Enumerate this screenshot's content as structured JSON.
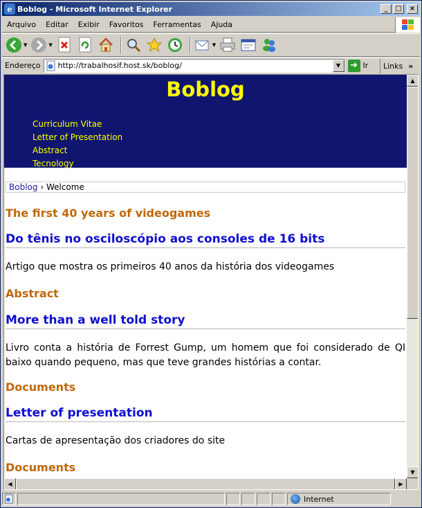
{
  "window": {
    "title": "Boblog - Microsoft Internet Explorer",
    "controls": {
      "minimize": "_",
      "maximize": "□",
      "close": "×"
    }
  },
  "menu": {
    "items": [
      "Arquivo",
      "Editar",
      "Exibir",
      "Favoritos",
      "Ferramentas",
      "Ajuda"
    ]
  },
  "address": {
    "label": "Endereço",
    "url": "http://trabalhosif.host.sk/boblog/",
    "go_label": "Ir",
    "links_label": "Links",
    "links_chevron": "»"
  },
  "page": {
    "site_title": "Boblog",
    "nav": [
      "Curriculum Vitae",
      "Letter of Presentation",
      "Abstract",
      "Tecnology"
    ],
    "breadcrumb": {
      "home": "Boblog",
      "separator": "›",
      "current": "Welcome"
    },
    "articles": [
      {
        "category": "The first 40 years of videogames",
        "title": "Do tênis no osciloscópio aos consoles de 16 bits",
        "description": "Artigo que mostra os primeiros 40 anos da história dos videogames"
      },
      {
        "category": "Abstract",
        "title": "More than a well told story",
        "description": "Livro conta a história de Forrest Gump, um homem que foi considerado de QI baixo quando pequeno, mas que teve grandes histórias a contar."
      },
      {
        "category": "Documents",
        "title": "Letter of presentation",
        "description": "Cartas de apresentação dos criadores do site"
      },
      {
        "category": "Documents"
      }
    ]
  },
  "status": {
    "zone": "Internet"
  },
  "colors": {
    "header_bg": "#10166f",
    "header_text": "#ffff00",
    "category": "#c0680a",
    "title": "#0d0dd0"
  }
}
